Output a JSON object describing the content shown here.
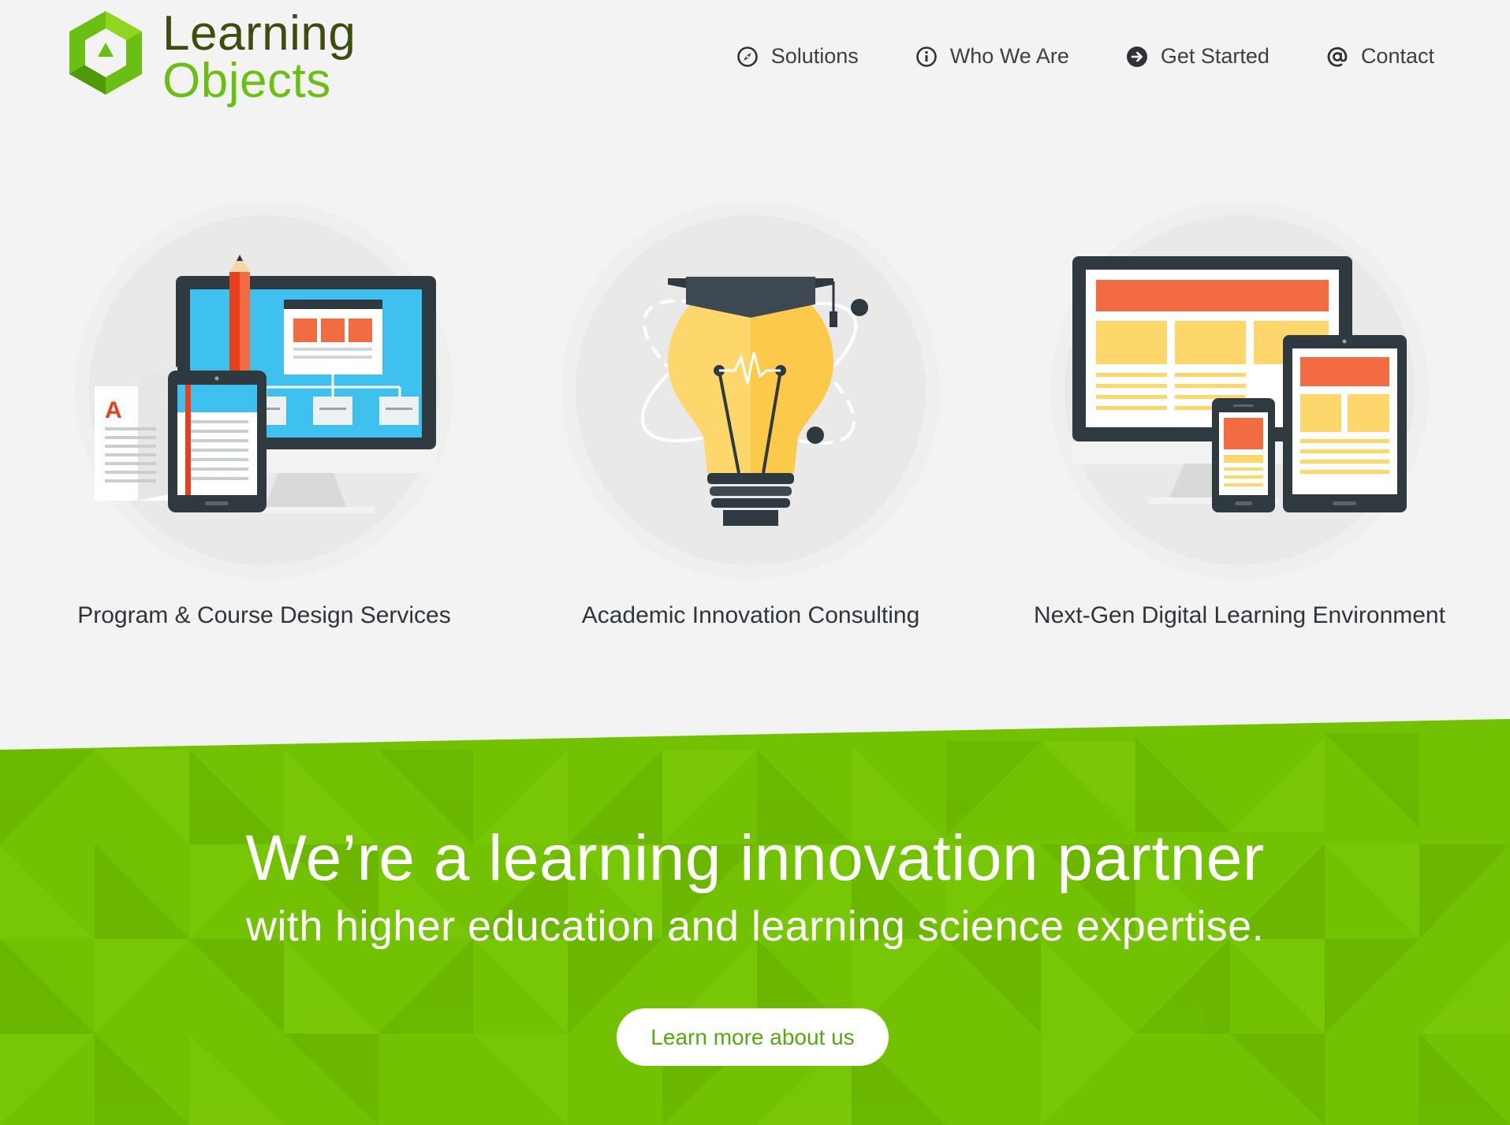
{
  "brand": {
    "line1": "Learning",
    "line2": "Objects",
    "green": "#6bbf14",
    "dark": "#3b4e0d"
  },
  "nav": [
    {
      "label": "Solutions",
      "icon": "compass-icon"
    },
    {
      "label": "Who We Are",
      "icon": "info-icon"
    },
    {
      "label": "Get Started",
      "icon": "arrow-right-circle-icon"
    },
    {
      "label": "Contact",
      "icon": "at-sign-icon"
    }
  ],
  "services": [
    {
      "label": "Program & Course Design Services",
      "icon": "monitor-tablet-document-icon"
    },
    {
      "label": "Academic Innovation Consulting",
      "icon": "graduation-lightbulb-icon"
    },
    {
      "label": "Next-Gen Digital Learning Environment",
      "icon": "responsive-devices-icon"
    }
  ],
  "hero": {
    "headline": "We’re a learning innovation partner",
    "subline": "with higher education and learning science expertise.",
    "cta_label": "Learn more about us",
    "background": "#72c102"
  }
}
